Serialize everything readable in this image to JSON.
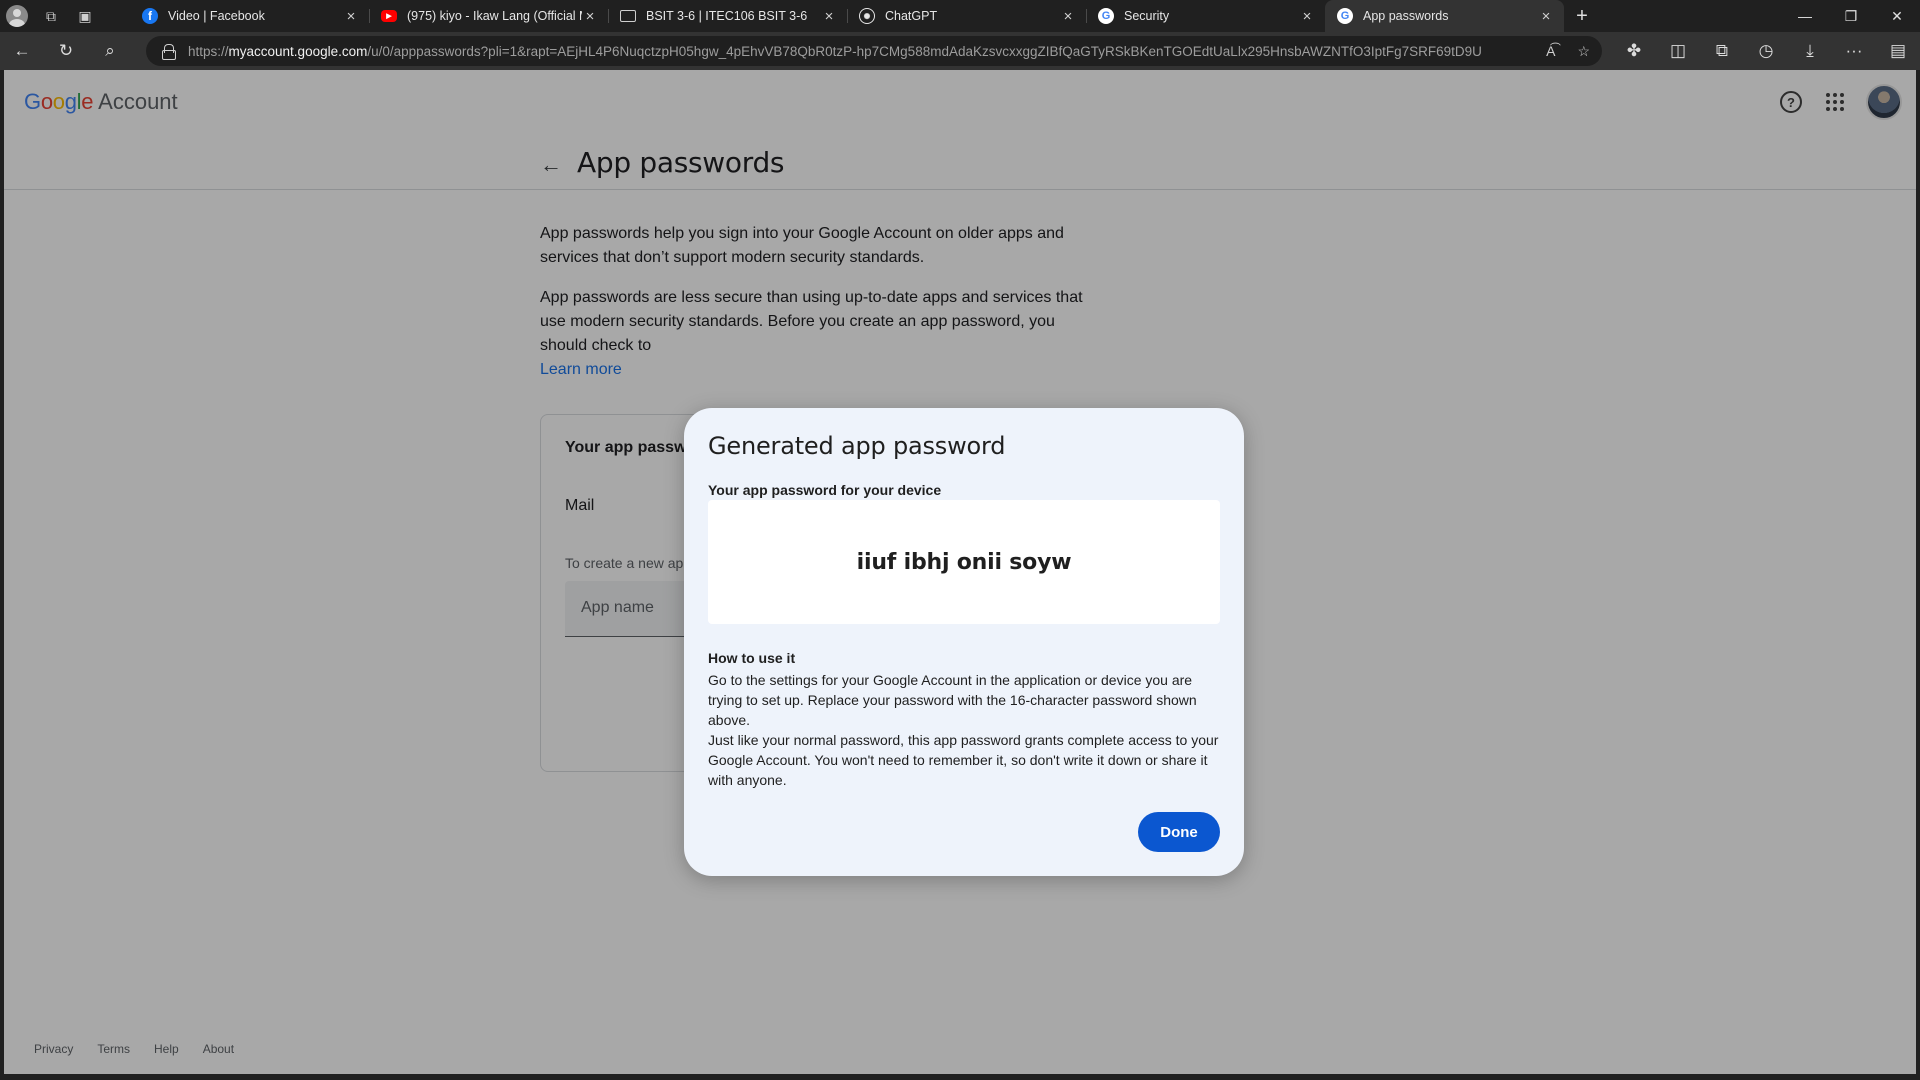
{
  "browser": {
    "tabs": [
      {
        "title": "Video | Facebook",
        "icon": "facebook-icon"
      },
      {
        "title": "(975) kiyo - Ikaw Lang (Official M",
        "icon": "youtube-icon"
      },
      {
        "title": "BSIT 3-6 | ITEC106 BSIT 3-6",
        "icon": "classroom-icon"
      },
      {
        "title": "ChatGPT",
        "icon": "chatgpt-icon"
      },
      {
        "title": "Security",
        "icon": "google-icon"
      },
      {
        "title": "App passwords",
        "icon": "google-icon",
        "active": true
      }
    ],
    "url_prefix": "https://",
    "url_host": "myaccount.google.com",
    "url_path": "/u/0/apppasswords?pli=1&rapt=AEjHL4P6NuqctzpH05hgw_4pEhvVB78QbR0tzP-hp7CMg588mdAdaKzsvcxxggZIBfQaGTyRSkBKenTGOEdtUaLlx295HnsbAWZNTfO3IptFg7SRF69tD9U"
  },
  "header": {
    "logo": {
      "g1": "G",
      "o1": "o",
      "o2": "o",
      "g2": "g",
      "l": "l",
      "e": "e"
    },
    "account_word": "Account",
    "help_glyph": "?"
  },
  "page": {
    "title": "App passwords",
    "para1": "App passwords help you sign into your Google Account on older apps and services that don’t support modern security standards.",
    "para2": "App passwords are less secure than using up-to-date apps and services that use modern security standards. Before you create an app password, you should check to",
    "learn_more": "Learn more",
    "card_title": "Your app passw",
    "card_mail": "Mail",
    "card_hint": "To create a new ap",
    "app_name_placeholder": "App name"
  },
  "dialog": {
    "title": "Generated app password",
    "subtitle": "Your app password for your device",
    "password": "iiuf ibhj onii soyw",
    "how_title": "How to use it",
    "how_text_1": "Go to the settings for your Google Account in the application or device you are trying to set up. Replace your password with the 16-character password shown above.",
    "how_text_2": "Just like your normal password, this app password grants complete access to your Google Account. You won't need to remember it, so don't write it down or share it with anyone.",
    "done_label": "Done"
  },
  "footer": {
    "privacy": "Privacy",
    "terms": "Terms",
    "help": "Help",
    "about": "About"
  },
  "colors": {
    "primary_button": "#0b57d0",
    "link": "#1a73e8",
    "dialog_bg": "#eef3fb"
  }
}
